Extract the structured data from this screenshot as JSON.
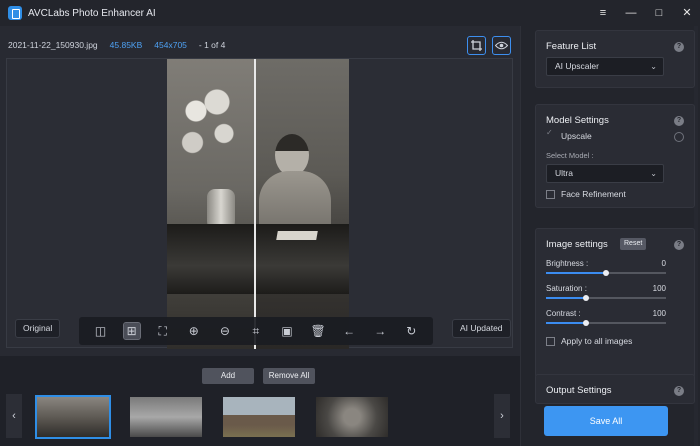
{
  "app": {
    "title": "AVCLabs Photo Enhancer AI"
  },
  "window": {
    "minimize": "—",
    "restore": "□",
    "close": "✕",
    "menu": "≡"
  },
  "info": {
    "filename": "2021-11-22_150930.jpg",
    "filesize": "45.85KB",
    "dimensions": "454x705",
    "counter": "- 1 of 4"
  },
  "viewer": {
    "original_label": "Original",
    "ai_label": "AI Updated"
  },
  "controls": [
    "split-view-icon",
    "compare-view-icon",
    "fit-screen-icon",
    "zoom-in-icon",
    "zoom-out-icon",
    "crop-icon",
    "save-icon",
    "delete-icon",
    "arrow-left-icon",
    "arrow-right-icon",
    "rotate-icon"
  ],
  "bottom": {
    "add_label": "Add",
    "remove_label": "Remove All"
  },
  "feature_list": {
    "title": "Feature List",
    "selected": "AI Upscaler"
  },
  "model_settings": {
    "title": "Model Settings",
    "upscale_label": "Upscale",
    "select_model_label": "Select Model :",
    "model": "Ultra",
    "face_refinement_label": "Face Refinement"
  },
  "image_settings": {
    "title": "Image settings",
    "reset_label": "Reset",
    "sliders": [
      {
        "label": "Brightness :",
        "value": "0",
        "level": 0.5
      },
      {
        "label": "Saturation :",
        "value": "100",
        "level": 0.33
      },
      {
        "label": "Contrast :",
        "value": "100",
        "level": 0.33
      }
    ],
    "apply_all_label": "Apply to all images"
  },
  "output_settings": {
    "title": "Output Settings"
  },
  "save_all_label": "Save All",
  "colors": {
    "accent": "#3d96f2",
    "selection": "#2f8ee6"
  }
}
